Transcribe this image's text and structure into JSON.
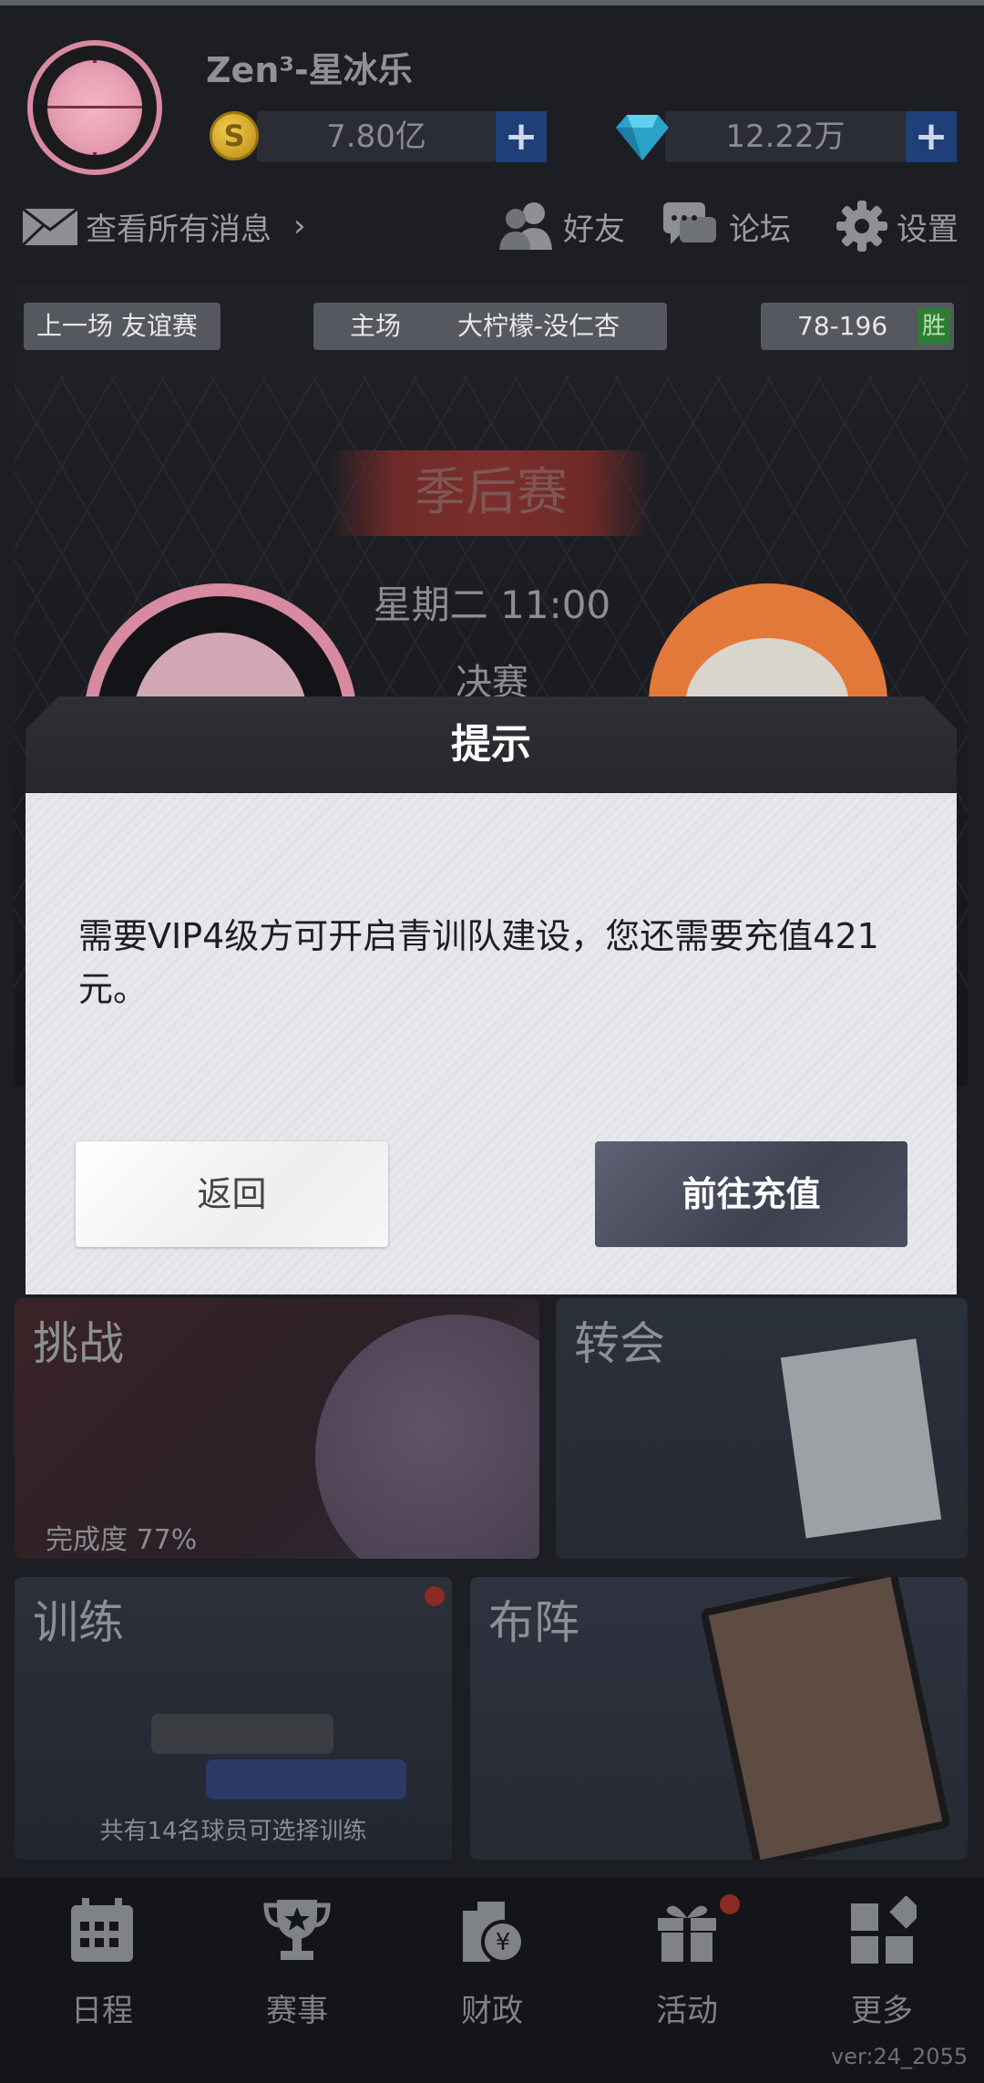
{
  "header": {
    "username": "Zen³-星冰乐",
    "coins": "7.80亿",
    "diamonds": "12.22万",
    "plus": "+",
    "coin_symbol": "S"
  },
  "nav_row": {
    "messages": "查看所有消息",
    "chevron": "›",
    "friends": "好友",
    "forum": "论坛",
    "settings": "设置"
  },
  "match": {
    "last_game": "上一场  友谊赛",
    "venue": "主场",
    "teams": "大柠檬-没仁杏",
    "score": "78-196",
    "result": "胜",
    "banner": "季后赛",
    "datetime": "星期二 11:00",
    "stage": "决赛"
  },
  "tiles": {
    "challenge": {
      "title": "挑战",
      "progress_label": "完成度 77%"
    },
    "transfer": {
      "title": "转会"
    },
    "train": {
      "title": "训练",
      "footer": "共有14名球员可选择训练"
    },
    "lineup": {
      "title": "布阵"
    }
  },
  "bottom_nav": [
    {
      "label": "日程",
      "icon": "calendar-icon"
    },
    {
      "label": "赛事",
      "icon": "trophy-icon"
    },
    {
      "label": "财政",
      "icon": "finance-icon"
    },
    {
      "label": "活动",
      "icon": "gift-icon"
    },
    {
      "label": "更多",
      "icon": "more-icon"
    }
  ],
  "version": "ver:24_2055",
  "dialog": {
    "title": "提示",
    "message": "需要VIP4级方可开启青训队建设，您还需要充值421元。",
    "back_label": "返回",
    "recharge_label": "前往充值"
  },
  "colors": {
    "background": "#1c1e24",
    "plus_button": "#1e3f78",
    "dialog_body": "#e5e6e9",
    "primary_button": "#3e4150",
    "badge_red": "#8b2b23"
  }
}
